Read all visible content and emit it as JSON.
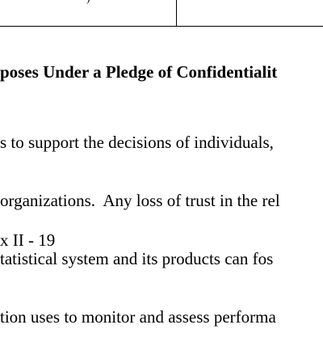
{
  "table_fragment": {
    "cell_glyph": ")"
  },
  "section": {
    "heading": "poses Under a Pledge of Confidentialit",
    "paragraph_lines": [
      "s to support the decisions of individuals,",
      "organizations.  Any loss of trust in the rel",
      "tatistical system and its products can fos",
      "tion uses to monitor and assess performa"
    ]
  },
  "footer": {
    "page_number": "x II - 19"
  }
}
